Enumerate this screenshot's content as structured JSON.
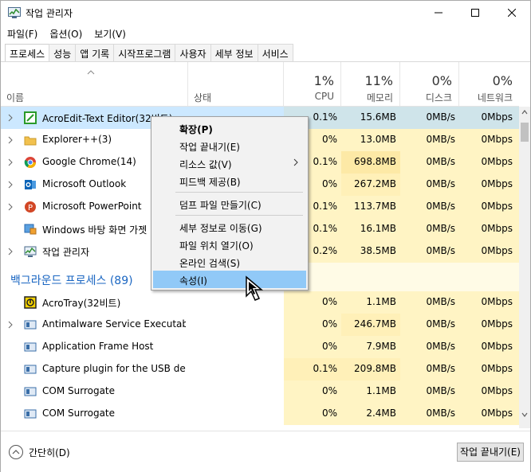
{
  "window": {
    "title": "작업 관리자"
  },
  "menubar": [
    {
      "label": "파일(F)"
    },
    {
      "label": "옵션(O)"
    },
    {
      "label": "보기(V)"
    }
  ],
  "tabs": [
    {
      "label": "프로세스",
      "active": true
    },
    {
      "label": "성능"
    },
    {
      "label": "앱 기록"
    },
    {
      "label": "시작프로그램"
    },
    {
      "label": "사용자"
    },
    {
      "label": "세부 정보"
    },
    {
      "label": "서비스"
    }
  ],
  "columns": {
    "name": "이름",
    "status": "상태",
    "cpu": {
      "pct": "1%",
      "label": "CPU"
    },
    "memory": {
      "pct": "11%",
      "label": "메모리"
    },
    "disk": {
      "pct": "0%",
      "label": "디스크"
    },
    "network": {
      "pct": "0%",
      "label": "네트워크"
    }
  },
  "rows": [
    {
      "name": "AcroEdit-Text Editor(32비트)",
      "icon": "acroedit-icon",
      "expandable": true,
      "cpu": "0.1%",
      "memory": "15.6MB",
      "disk": "0MB/s",
      "network": "0Mbps",
      "selected": true
    },
    {
      "name": "Explorer++(3)",
      "icon": "folder-icon",
      "expandable": true,
      "cpu": "0%",
      "memory": "13.0MB",
      "disk": "0MB/s",
      "network": "0Mbps"
    },
    {
      "name": "Google Chrome(14)",
      "icon": "chrome-icon",
      "expandable": true,
      "cpu": "0.1%",
      "memory": "698.8MB",
      "disk": "0MB/s",
      "network": "0Mbps"
    },
    {
      "name": "Microsoft Outlook",
      "icon": "outlook-icon",
      "expandable": true,
      "cpu": "0%",
      "memory": "267.2MB",
      "disk": "0MB/s",
      "network": "0Mbps"
    },
    {
      "name": "Microsoft PowerPoint",
      "icon": "powerpoint-icon",
      "expandable": true,
      "cpu": "0.1%",
      "memory": "113.7MB",
      "disk": "0MB/s",
      "network": "0Mbps"
    },
    {
      "name": "Windows 바탕 화면 가젯",
      "icon": "gadget-icon",
      "expandable": false,
      "cpu": "0.1%",
      "memory": "16.1MB",
      "disk": "0MB/s",
      "network": "0Mbps"
    },
    {
      "name": "작업 관리자",
      "icon": "task-manager-icon",
      "expandable": true,
      "cpu": "0.2%",
      "memory": "38.5MB",
      "disk": "0MB/s",
      "network": "0Mbps"
    }
  ],
  "group": {
    "label": "백그라운드 프로세스 (89)"
  },
  "bg_rows": [
    {
      "name": "AcroTray(32비트)",
      "icon": "acrotray-icon",
      "expandable": false,
      "cpu": "0%",
      "memory": "1.1MB",
      "disk": "0MB/s",
      "network": "0Mbps"
    },
    {
      "name": "Antimalware Service Executable",
      "icon": "service-icon",
      "expandable": true,
      "cpu": "0%",
      "memory": "246.7MB",
      "disk": "0MB/s",
      "network": "0Mbps"
    },
    {
      "name": "Application Frame Host",
      "icon": "service-icon",
      "expandable": false,
      "cpu": "0%",
      "memory": "7.9MB",
      "disk": "0MB/s",
      "network": "0Mbps"
    },
    {
      "name": "Capture plugin for the USB dev...",
      "icon": "service-icon",
      "expandable": false,
      "cpu": "0.1%",
      "memory": "209.8MB",
      "disk": "0MB/s",
      "network": "0Mbps"
    },
    {
      "name": "COM Surrogate",
      "icon": "service-icon",
      "expandable": false,
      "cpu": "0%",
      "memory": "1.1MB",
      "disk": "0MB/s",
      "network": "0Mbps"
    },
    {
      "name": "COM Surrogate",
      "icon": "service-icon",
      "expandable": false,
      "cpu": "0%",
      "memory": "2.4MB",
      "disk": "0MB/s",
      "network": "0Mbps"
    }
  ],
  "context_menu": [
    {
      "label": "확장(P)",
      "bold": true
    },
    {
      "label": "작업 끝내기(E)"
    },
    {
      "label": "리소스 값(V)",
      "submenu": true
    },
    {
      "label": "피드백 제공(B)"
    },
    {
      "label": "덤프 파일 만들기(C)"
    },
    {
      "label": "세부 정보로 이동(G)"
    },
    {
      "label": "파일 위치 열기(O)"
    },
    {
      "label": "온라인 검색(S)"
    },
    {
      "label": "속성(I)",
      "hover": true
    }
  ],
  "footer": {
    "collapse_label": "간단히(D)",
    "end_task_label": "작업 끝내기(E)"
  },
  "colors": {
    "accent": "#1a66c2",
    "selection": "#cce8ff",
    "heat": "#fff4c4",
    "menu_hover": "#91c9f7"
  }
}
